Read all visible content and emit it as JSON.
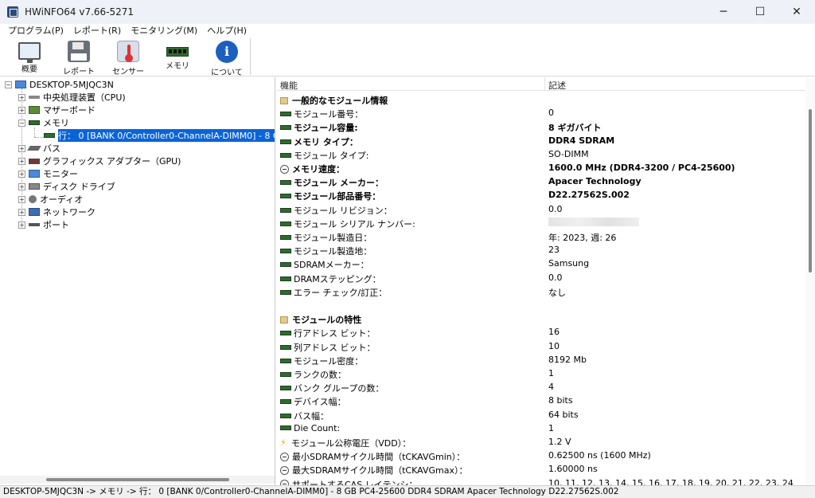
{
  "window": {
    "title": "HWiNFO64 v7.66-5271",
    "minimize": "─",
    "maximize": "☐",
    "close": "✕"
  },
  "menu": [
    "プログラム(P)",
    "レポート(R)",
    "モニタリング(M)",
    "ヘルプ(H)"
  ],
  "toolbar": {
    "summary": "概要",
    "report": "レポート",
    "sensors": "センサー",
    "memory": "メモリ",
    "about": "について",
    "about_glyph": "i"
  },
  "tree": {
    "root": "DESKTOP-5MJQC3N",
    "items": [
      {
        "label": "中央処理装置（CPU)",
        "icon": "cpu-icon"
      },
      {
        "label": "マザーボード",
        "icon": "motherboard-icon"
      },
      {
        "label": "メモリ",
        "icon": "memory-icon"
      },
      {
        "label": "バス",
        "icon": "bus-icon"
      },
      {
        "label": "グラフィックス アダプター（GPU)",
        "icon": "gpu-icon"
      },
      {
        "label": "モニター",
        "icon": "monitor-icon"
      },
      {
        "label": "ディスク ドライブ",
        "icon": "disk-icon"
      },
      {
        "label": "オーディオ",
        "icon": "audio-icon"
      },
      {
        "label": "ネットワーク",
        "icon": "network-icon"
      },
      {
        "label": "ポート",
        "icon": "port-icon"
      }
    ],
    "selected_child": "行： 0 [BANK 0/Controller0-ChannelA-DIMM0] - 8 GB PC",
    "expand_plus": "+",
    "expand_minus": "−"
  },
  "details": {
    "col_feature": "機能",
    "col_description": "記述",
    "rows": [
      {
        "name": "一般的なモジュール情報",
        "value": "",
        "type": "section"
      },
      {
        "name": "モジュール番号：",
        "value": "0",
        "type": "ram"
      },
      {
        "name": "モジュール容量:",
        "value": "8 ギガバイト",
        "type": "ram",
        "bold": true
      },
      {
        "name": "メモリ タイプ：",
        "value": "DDR4 SDRAM",
        "type": "ram",
        "bold": true
      },
      {
        "name": "モジュール タイプ:",
        "value": "SO-DIMM",
        "type": "ram"
      },
      {
        "name": "メモリ速度：",
        "value": "1600.0 MHz (DDR4-3200 / PC4-25600)",
        "type": "clock",
        "bold": true
      },
      {
        "name": "モジュール メーカー：",
        "value": "Apacer Technology",
        "type": "ram",
        "bold": true
      },
      {
        "name": "モジュール部品番号：",
        "value": "D22.27562S.002",
        "type": "ram",
        "bold": true
      },
      {
        "name": "モジュール リビジョン：",
        "value": "0.0",
        "type": "ram"
      },
      {
        "name": "モジュール シリアル ナンバー:",
        "value": "",
        "type": "ram",
        "blurred": true
      },
      {
        "name": "モジュール製造日：",
        "value": "年: 2023, 週: 26",
        "type": "ram"
      },
      {
        "name": "モジュール製造地：",
        "value": "23",
        "type": "ram"
      },
      {
        "name": "SDRAMメーカー：",
        "value": "Samsung",
        "type": "ram"
      },
      {
        "name": "DRAMステッピング：",
        "value": "0.0",
        "type": "ram"
      },
      {
        "name": "エラー チェック/訂正：",
        "value": "なし",
        "type": "ram"
      },
      {
        "name": "",
        "value": "",
        "type": "blank"
      },
      {
        "name": "モジュールの特性",
        "value": "",
        "type": "section"
      },
      {
        "name": "行アドレス ビット：",
        "value": "16",
        "type": "ram"
      },
      {
        "name": "列アドレス ビット：",
        "value": "10",
        "type": "ram"
      },
      {
        "name": "モジュール密度：",
        "value": "8192 Mb",
        "type": "ram"
      },
      {
        "name": "ランクの数：",
        "value": "1",
        "type": "ram"
      },
      {
        "name": "バンク グループの数：",
        "value": "4",
        "type": "ram"
      },
      {
        "name": "デバイス幅：",
        "value": "8 bits",
        "type": "ram"
      },
      {
        "name": "バス幅：",
        "value": "64 bits",
        "type": "ram"
      },
      {
        "name": "Die Count:",
        "value": "1",
        "type": "ram"
      },
      {
        "name": "モジュール公称電圧（VDD）：",
        "value": "1.2 V",
        "type": "bolt"
      },
      {
        "name": "最小SDRAMサイクル時間（tCKAVGmin）：",
        "value": "0.62500 ns (1600 MHz)",
        "type": "clock"
      },
      {
        "name": "最大SDRAMサイクル時間（tCKAVGmax）：",
        "value": "1.60000 ns",
        "type": "clock"
      },
      {
        "name": "サポートするCAS レイテンシ：",
        "value": "10, 11, 12, 13, 14, 15, 16, 17, 18, 19, 20, 21, 22, 23, 24",
        "type": "clock"
      }
    ]
  },
  "status": "DESKTOP-5MJQC3N -> メモリ -> 行： 0 [BANK 0/Controller0-ChannelA-DIMM0] - 8 GB PC4-25600 DDR4 SDRAM Apacer Technology D22.27562S.002",
  "colors": {
    "selection": "#0a64d8",
    "titlebar": "#eef2f8"
  }
}
